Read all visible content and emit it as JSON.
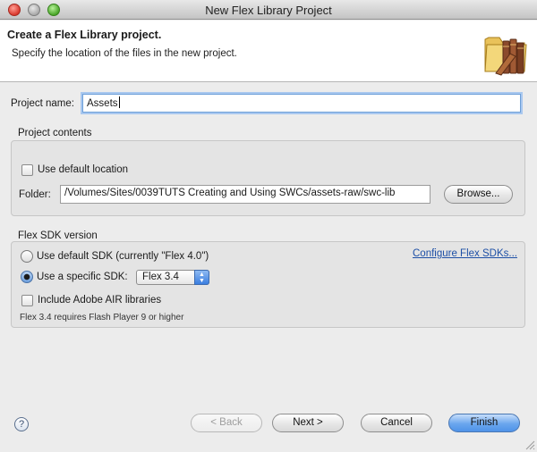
{
  "window": {
    "title": "New Flex Library Project"
  },
  "header": {
    "title": "Create a Flex Library project.",
    "description": "Specify the location of the files in the new project.",
    "icon": "folder-books-icon"
  },
  "project_name": {
    "label": "Project name:",
    "value": "Assets"
  },
  "project_contents": {
    "title": "Project contents",
    "use_default_location_label": "Use default location",
    "use_default_location_checked": false,
    "folder_label": "Folder:",
    "folder_value": "/Volumes/Sites/0039TUTS Creating and Using SWCs/assets-raw/swc-lib",
    "browse_label": "Browse..."
  },
  "flex_sdk": {
    "title": "Flex SDK version",
    "default_sdk_label": "Use default SDK (currently \"Flex 4.0\")",
    "configure_link": "Configure Flex SDKs...",
    "specific_sdk_label": "Use a specific SDK:",
    "selected_option": "specific",
    "sdk_select_value": "Flex 3.4",
    "include_air_label": "Include Adobe AIR libraries",
    "include_air_checked": false,
    "requirement_note": "Flex 3.4 requires Flash Player 9 or higher"
  },
  "buttons": {
    "back": "< Back",
    "next": "Next >",
    "cancel": "Cancel",
    "finish": "Finish"
  },
  "colors": {
    "accent_blue": "#4f93e8",
    "link": "#1d4fa6",
    "dialog_bg": "#ececec"
  }
}
